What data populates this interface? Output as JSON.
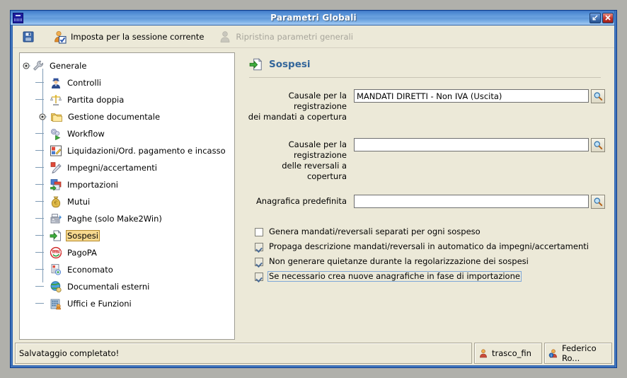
{
  "window": {
    "title": "Parametri Globali",
    "app_icon": "magic-app-icon",
    "buttons": [
      {
        "name": "restore-button",
        "icon": "restore-down-icon",
        "label": ""
      },
      {
        "name": "close-button",
        "icon": "close-icon",
        "label": ""
      }
    ]
  },
  "toolbar": {
    "items": [
      {
        "name": "save-button",
        "icon": "floppy-save-icon",
        "label": "",
        "enabled": true
      },
      {
        "name": "set-session-button",
        "icon": "user-check-icon",
        "label": "Imposta per la sessione corrente",
        "enabled": true
      },
      {
        "name": "restore-general-params-button",
        "icon": "user-grey-icon",
        "label": "Ripristina parametri generali",
        "enabled": false
      }
    ]
  },
  "tree": {
    "root": {
      "label": "Generale",
      "icon": "wrench-icon",
      "expanded": true
    },
    "items": [
      {
        "label": "Controlli",
        "icon": "policeman-icon",
        "expandable": false,
        "selected": false
      },
      {
        "label": "Partita doppia",
        "icon": "scales-icon",
        "expandable": false,
        "selected": false
      },
      {
        "label": "Gestione documentale",
        "icon": "folders-icon",
        "expandable": true,
        "selected": false
      },
      {
        "label": "Workflow",
        "icon": "gears-play-icon",
        "expandable": false,
        "selected": false
      },
      {
        "label": "Liquidazioni/Ord. pagamento e incasso",
        "icon": "stamp-icon",
        "expandable": false,
        "selected": false
      },
      {
        "label": "Impegni/accertamenti",
        "icon": "pen-document-icon",
        "expandable": false,
        "selected": false
      },
      {
        "label": "Importazioni",
        "icon": "import-arrow-icon",
        "expandable": false,
        "selected": false
      },
      {
        "label": "Mutui",
        "icon": "money-bag-icon",
        "expandable": false,
        "selected": false
      },
      {
        "label": "Paghe (solo Make2Win)",
        "icon": "cash-register-icon",
        "expandable": false,
        "selected": false
      },
      {
        "label": "Sospesi",
        "icon": "green-arrow-document-icon",
        "expandable": false,
        "selected": true
      },
      {
        "label": "PagoPA",
        "icon": "pagopa-icon",
        "expandable": false,
        "selected": false
      },
      {
        "label": "Economato",
        "icon": "economato-document-icon",
        "expandable": false,
        "selected": false
      },
      {
        "label": "Documentali esterni",
        "icon": "globe-icon",
        "expandable": false,
        "selected": false
      },
      {
        "label": "Uffici e Funzioni",
        "icon": "office-building-icon",
        "expandable": false,
        "selected": false
      }
    ]
  },
  "panel": {
    "title": "Sospesi",
    "icon": "green-arrow-document-icon",
    "fields": [
      {
        "name": "causale-mandati-copertura",
        "label": "Causale per la registrazione\ndei mandati a copertura",
        "label_line1": "Causale per la registrazione",
        "label_line2": "dei mandati a copertura",
        "value": "MANDATI DIRETTI - Non IVA (Uscita)",
        "placeholder": "",
        "lookup_icon": "magnifier-icon"
      },
      {
        "name": "causale-reversali-copertura",
        "label_line1": "Causale per la registrazione",
        "label_line2": "delle reversali a copertura",
        "value": "",
        "placeholder": "",
        "lookup_icon": "magnifier-icon"
      },
      {
        "name": "anagrafica-predefinita",
        "label_line1": "",
        "label_line2": "Anagrafica predefinita",
        "value": "",
        "placeholder": "",
        "lookup_icon": "magnifier-icon"
      }
    ],
    "checkboxes": [
      {
        "name": "genera-mandati-separati",
        "label": "Genera mandati/reversali separati per ogni sospeso",
        "checked": false,
        "focused": false
      },
      {
        "name": "propaga-descrizione",
        "label": "Propaga descrizione mandati/reversali in automatico da impegni/accertamenti",
        "checked": true,
        "focused": false
      },
      {
        "name": "non-generare-quietanze",
        "label": "Non generare quietanze durante la regolarizzazione dei sospesi",
        "checked": true,
        "focused": false
      },
      {
        "name": "crea-nuove-anagrafiche",
        "label": "Se necessario crea nuove anagrafiche in fase di importazione",
        "checked": true,
        "focused": true
      }
    ]
  },
  "statusbar": {
    "message": "Salvataggio completato!",
    "database": {
      "label": "trasco_fin",
      "icon": "db-user-icon"
    },
    "user": {
      "label": "Federico Ro...",
      "icon": "user-info-icon"
    }
  },
  "colors": {
    "title_bar": "#4d89d2",
    "panel_bg": "#ece9d8",
    "tree_bg": "#ffffff",
    "selection": "#f7d98f",
    "panel_title": "#33669a",
    "accent_green": "#2fa02f",
    "disabled_text": "#a7a59b"
  }
}
